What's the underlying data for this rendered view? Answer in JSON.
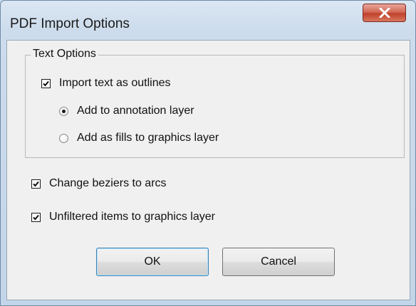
{
  "window": {
    "title": "PDF Import Options"
  },
  "title_bar": {
    "close_icon": "close-icon"
  },
  "text_options": {
    "legend": "Text Options",
    "import_as_outlines": {
      "label": "Import text as outlines",
      "checked": true
    },
    "radios": [
      {
        "label": "Add to annotation layer",
        "selected": true
      },
      {
        "label": "Add as fills to graphics layer",
        "selected": false
      }
    ]
  },
  "options": [
    {
      "label": "Change beziers to arcs",
      "checked": true
    },
    {
      "label": "Unfiltered items to graphics layer",
      "checked": true
    }
  ],
  "buttons": {
    "ok": "OK",
    "cancel": "Cancel"
  },
  "colors": {
    "close_button": "#c7422c",
    "client_bg": "#f0f0f0",
    "frame": "#c3d5e8"
  }
}
